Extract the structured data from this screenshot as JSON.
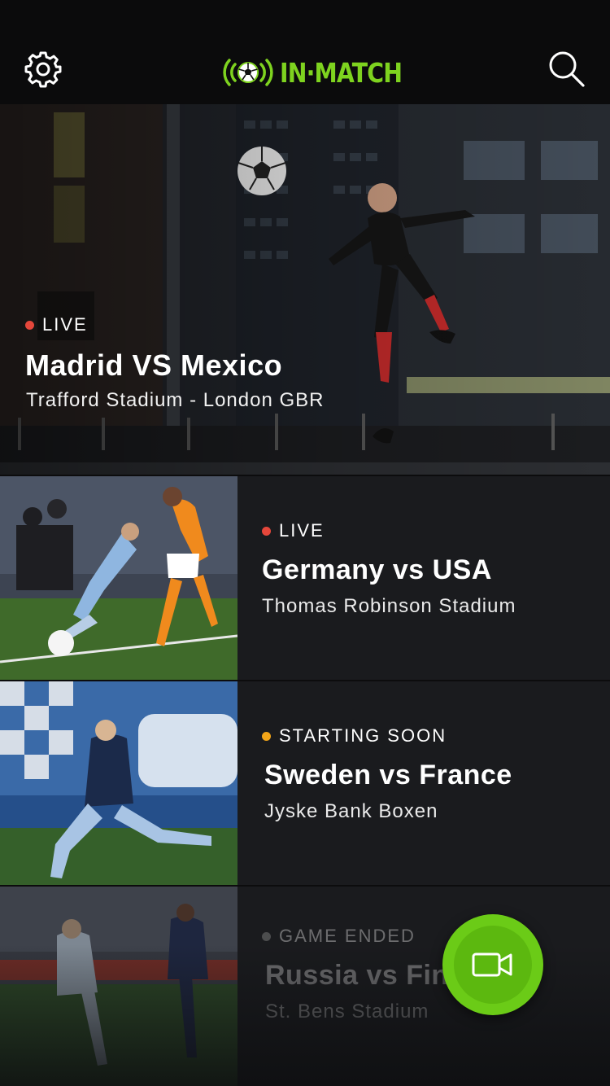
{
  "app": {
    "name": "IN·MATCH",
    "brand_color": "#7ed31f",
    "icons": {
      "settings": "gear-icon",
      "search": "search-icon",
      "logo": "soccer-ball-broadcast-icon",
      "fab": "video-camera-icon"
    }
  },
  "featured": {
    "status": "LIVE",
    "status_color": "#e5473b",
    "title": "Madrid VS Mexico",
    "venue": "Trafford Stadium - London GBR"
  },
  "matches": [
    {
      "status": "LIVE",
      "status_color": "#e5473b",
      "title": "Germany vs USA",
      "venue": "Thomas Robinson Stadium"
    },
    {
      "status": "STARTING SOON",
      "status_color": "#f2a519",
      "title": "Sweden vs France",
      "venue": "Jyske Bank Boxen"
    },
    {
      "status": "GAME ENDED",
      "status_color": "#8a8a8a",
      "title": "Russia vs Finland",
      "venue": "St. Bens Stadium"
    }
  ]
}
